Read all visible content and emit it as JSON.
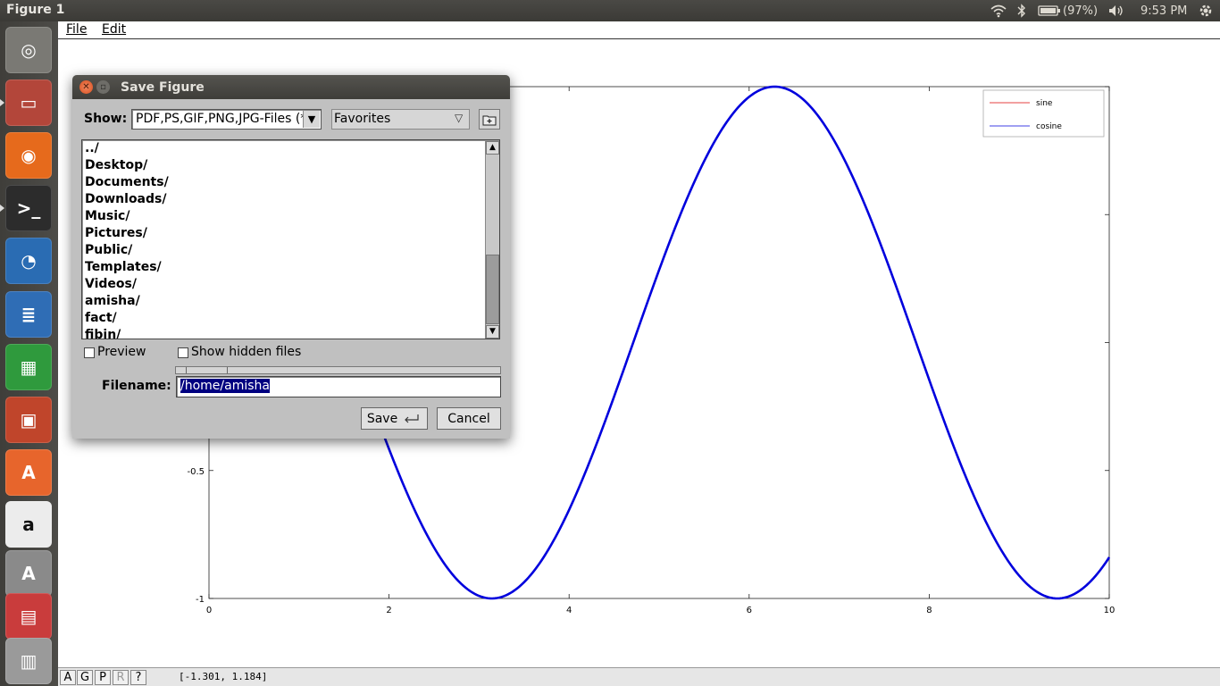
{
  "window": {
    "title": "Figure 1"
  },
  "top_panel": {
    "battery_text": "(97%)",
    "clock": "9:53 PM",
    "icons": [
      "wifi-icon",
      "bluetooth-icon",
      "battery-icon",
      "volume-icon",
      "settings-gear-icon"
    ]
  },
  "launcher": {
    "items": [
      {
        "name": "ubuntu-dash-icon",
        "glyph": "◎",
        "color": "#7a7974"
      },
      {
        "name": "files-icon",
        "glyph": "▭",
        "color": "#b3463a"
      },
      {
        "name": "firefox-icon",
        "glyph": "◉",
        "color": "#e66a1c"
      },
      {
        "name": "terminal-icon",
        "glyph": ">_",
        "color": "#2c2c2c"
      },
      {
        "name": "octave-icon",
        "glyph": "◔",
        "color": "#2a6cb3"
      },
      {
        "name": "libreoffice-writer-icon",
        "glyph": "≣",
        "color": "#2f6db5"
      },
      {
        "name": "libreoffice-calc-icon",
        "glyph": "▦",
        "color": "#2f9a3d"
      },
      {
        "name": "libreoffice-impress-icon",
        "glyph": "▣",
        "color": "#c0452b"
      },
      {
        "name": "software-center-icon",
        "glyph": "A",
        "color": "#e7652c"
      },
      {
        "name": "amazon-icon",
        "glyph": "a",
        "color": "#ececec"
      },
      {
        "name": "update-manager-icon",
        "glyph": "A",
        "color": "#8a8a8a"
      },
      {
        "name": "workspace-switcher-icon",
        "glyph": "▤",
        "color": "#c93c3c"
      },
      {
        "name": "trash-icon",
        "glyph": "▥",
        "color": "#9a9a9a"
      }
    ]
  },
  "menubar": {
    "file": "File",
    "edit": "Edit"
  },
  "statusbar": {
    "buttons": [
      "A",
      "G",
      "P",
      "R",
      "?"
    ],
    "coords": "[-1.301, 1.184]"
  },
  "dialog": {
    "title": "Save Figure",
    "show_label": "Show:",
    "filter_value": "PDF,PS,GIF,PNG,JPG-Files (*",
    "favorites_label": "Favorites",
    "files": [
      "../",
      "Desktop/",
      "Documents/",
      "Downloads/",
      "Music/",
      "Pictures/",
      "Public/",
      "Templates/",
      "Videos/",
      "amisha/",
      "fact/",
      "fibin/"
    ],
    "preview_label": "Preview",
    "hidden_label": "Show hidden files",
    "filename_label": "Filename:",
    "filename_value": "/home/amisha",
    "save_label": "Save",
    "cancel_label": "Cancel"
  },
  "chart_data": {
    "type": "line",
    "title": "",
    "xlabel": "",
    "ylabel": "",
    "xlim": [
      0,
      10
    ],
    "ylim": [
      -1,
      1
    ],
    "x_ticks": [
      "0",
      "2",
      "4",
      "6",
      "8",
      "10"
    ],
    "y_ticks": [
      "-1",
      "-0.5"
    ],
    "legend_position": "top-right",
    "series": [
      {
        "name": "sine",
        "function": "sin(x - 3*pi/2)",
        "color": "#dd0000",
        "width": 1.2
      },
      {
        "name": "cosine",
        "function": "cos(x)",
        "color": "#0000dd",
        "width": 2.6
      }
    ]
  }
}
